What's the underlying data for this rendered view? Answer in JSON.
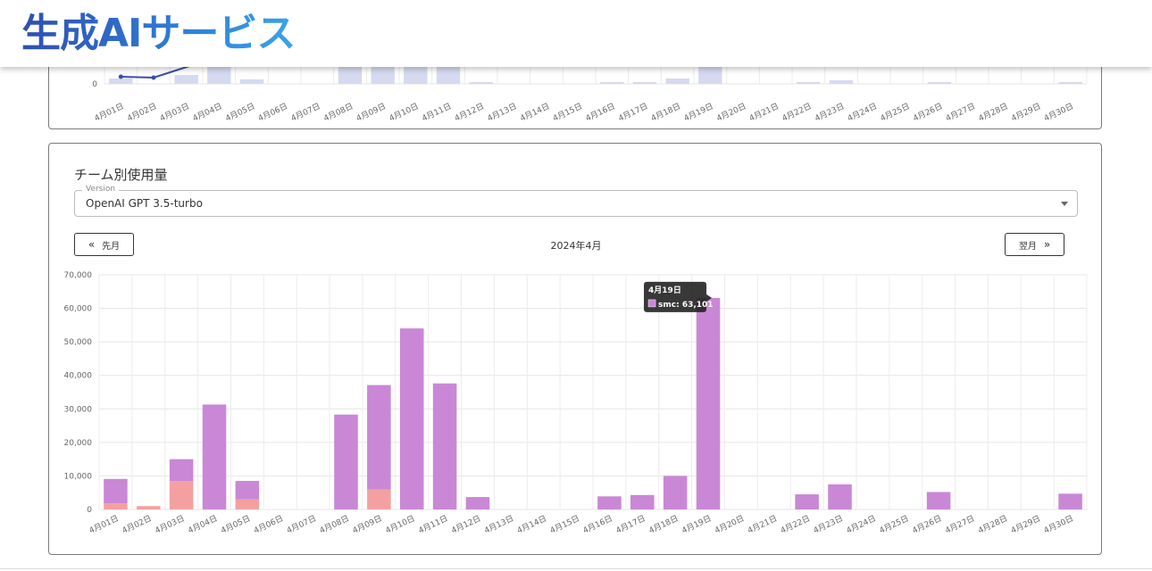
{
  "header": {
    "title": "生成AIサービス"
  },
  "top_chart": {
    "y_tick": "0",
    "dates": [
      "4月01日",
      "4月02日",
      "4月03日",
      "4月04日",
      "4月05日",
      "4月06日",
      "4月07日",
      "4月08日",
      "4月09日",
      "4月10日",
      "4月11日",
      "4月12日",
      "4月13日",
      "4月14日",
      "4月15日",
      "4月16日",
      "4月17日",
      "4月18日",
      "4月19日",
      "4月20日",
      "4月21日",
      "4月22日",
      "4月23日",
      "4月24日",
      "4月25日",
      "4月26日",
      "4月27日",
      "4月28日",
      "4月29日",
      "4月30日"
    ]
  },
  "team_usage": {
    "title": "チーム別使用量",
    "version_label": "Version",
    "version_value": "OpenAI GPT 3.5-turbo",
    "prev_label": "先月",
    "next_label": "翌月",
    "prev_icon": "double-chevron-left-icon",
    "next_icon": "double-chevron-right-icon",
    "month_label": "2024年4月"
  },
  "tooltip": {
    "title": "4月19日",
    "label": "smc: 63,101"
  },
  "chart_data": {
    "type": "bar",
    "stacked": true,
    "categories": [
      "4月01日",
      "4月02日",
      "4月03日",
      "4月04日",
      "4月05日",
      "4月06日",
      "4月07日",
      "4月08日",
      "4月09日",
      "4月10日",
      "4月11日",
      "4月12日",
      "4月13日",
      "4月14日",
      "4月15日",
      "4月16日",
      "4月17日",
      "4月18日",
      "4月19日",
      "4月20日",
      "4月21日",
      "4月22日",
      "4月23日",
      "4月24日",
      "4月25日",
      "4月26日",
      "4月27日",
      "4月28日",
      "4月29日",
      "4月30日"
    ],
    "series": [
      {
        "color": "#f4a0a0",
        "values": [
          1800,
          1000,
          8500,
          0,
          3000,
          0,
          0,
          0,
          6000,
          0,
          0,
          0,
          0,
          0,
          0,
          0,
          0,
          0,
          0,
          0,
          0,
          0,
          0,
          0,
          0,
          0,
          0,
          0,
          0,
          0
        ]
      },
      {
        "name": "smc",
        "color": "#c987d6",
        "values": [
          7300,
          0,
          6500,
          31300,
          5500,
          0,
          0,
          28300,
          31100,
          54000,
          37600,
          3700,
          0,
          0,
          0,
          3900,
          4300,
          10000,
          63101,
          0,
          0,
          4500,
          7500,
          0,
          0,
          5200,
          0,
          0,
          0,
          4700
        ]
      }
    ],
    "yticks": [
      "0",
      "10,000",
      "20,000",
      "30,000",
      "40,000",
      "50,000",
      "60,000",
      "70,000"
    ],
    "ylim": [
      0,
      70000
    ],
    "grid": true
  }
}
